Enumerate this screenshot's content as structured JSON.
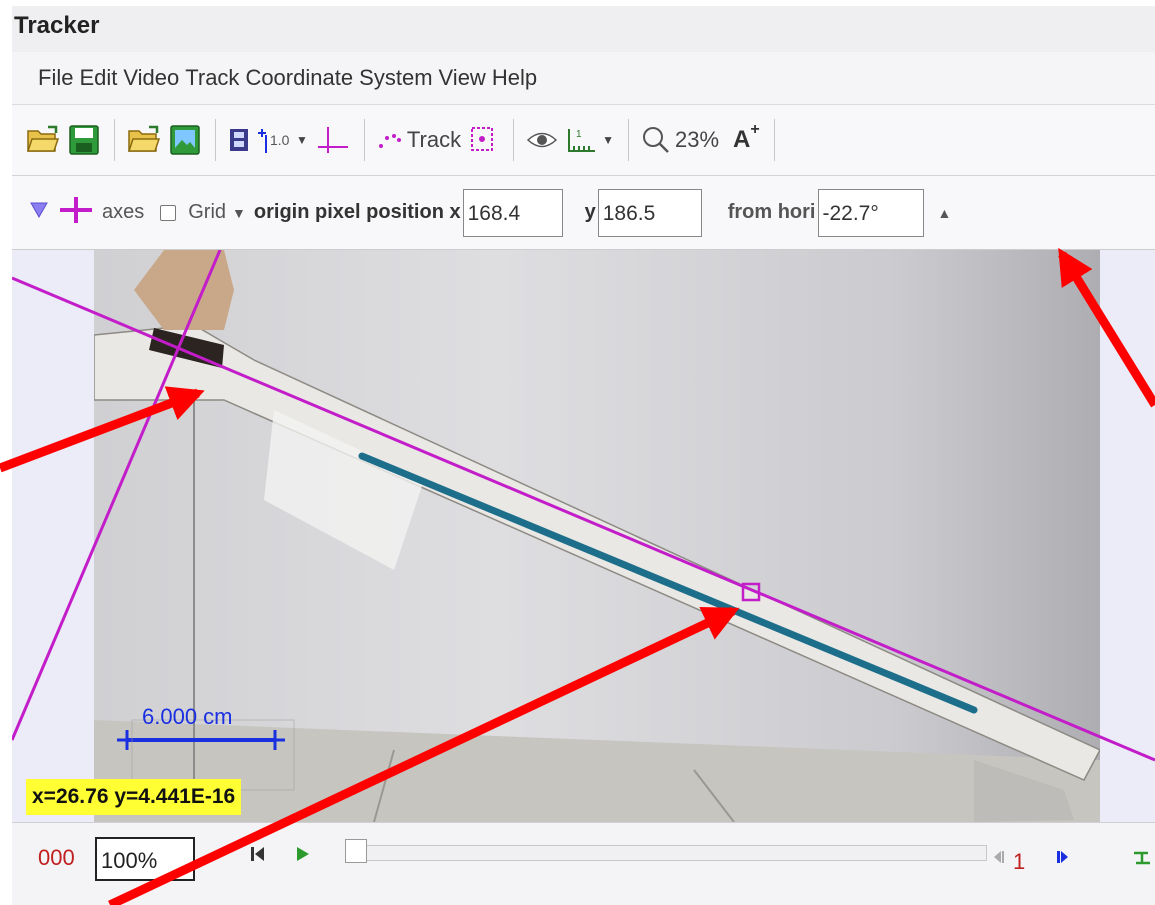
{
  "window": {
    "title": "Tracker"
  },
  "menu": {
    "items": [
      "File",
      "Edit",
      "Video",
      "Track",
      "Coordinate System",
      "View",
      "Help"
    ]
  },
  "toolbar": {
    "track_label": "Track",
    "zoom_label": "23%",
    "font_label": "A"
  },
  "axes_bar": {
    "axes_label": "axes",
    "grid_label": "Grid",
    "origin_label": "origin pixel position x",
    "x_value": "168.4",
    "y_label": "y",
    "y_value": "186.5",
    "angle_label": "from hori",
    "angle_value": "-22.7°"
  },
  "video": {
    "calibration_label": "6.000 cm",
    "coordinate_readout": "x=26.76  y=4.441E-16"
  },
  "player": {
    "frame_count": "000",
    "zoom": "100%",
    "step_number": "1"
  },
  "colors": {
    "axes": "#c21dc9",
    "calibration": "#1a2fe0",
    "arrow": "#ff0000",
    "readout_bg": "#ffff33"
  }
}
